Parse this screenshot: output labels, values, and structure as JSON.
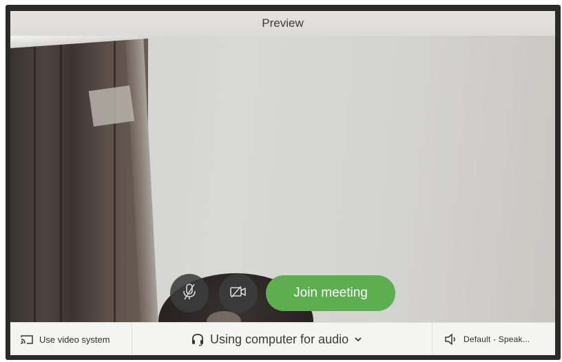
{
  "window": {
    "title": "Preview"
  },
  "controls": {
    "mute_icon": "microphone-muted-icon",
    "camera_icon": "camera-off-icon",
    "join_label": "Join meeting",
    "join_color": "#5cae4f"
  },
  "bottom_bar": {
    "video_system_label": "Use video system",
    "video_system_icon": "cast-screen-icon",
    "audio_label": "Using computer for audio",
    "audio_icon": "headset-icon",
    "speaker_label": "Default - Speak...",
    "speaker_icon": "speaker-icon"
  }
}
